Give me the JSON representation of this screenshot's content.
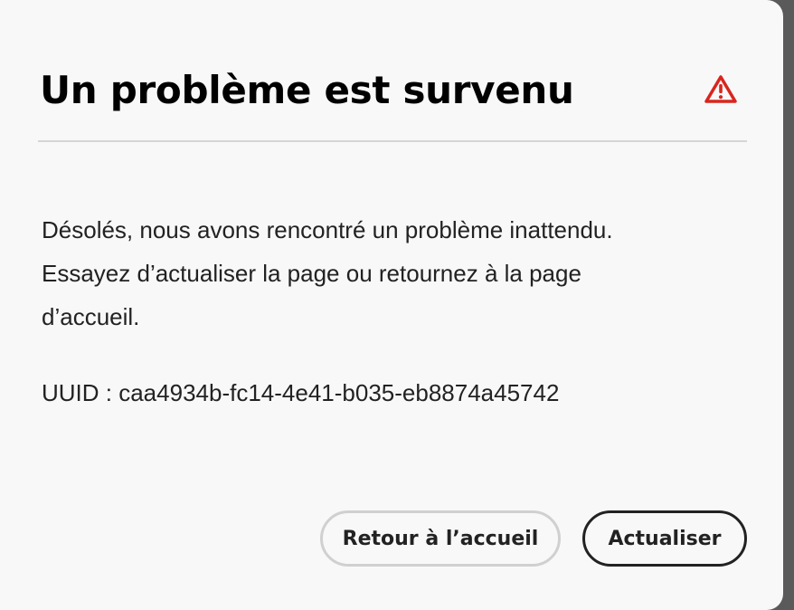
{
  "dialog": {
    "title": "Un problème est survenu",
    "icon": "alert-triangle-icon",
    "icon_color": "#d7261e",
    "message_lines": [
      "Désolés, nous avons rencontré un problème inattendu.",
      "Essayez d’actualiser la page ou retournez à la page",
      "d’accueil."
    ],
    "uuid_text": "UUID : caa4934b-fc14-4e41-b035-eb8874a45742",
    "buttons": {
      "home_label": "Retour à l’accueil",
      "refresh_label": "Actualiser"
    }
  }
}
